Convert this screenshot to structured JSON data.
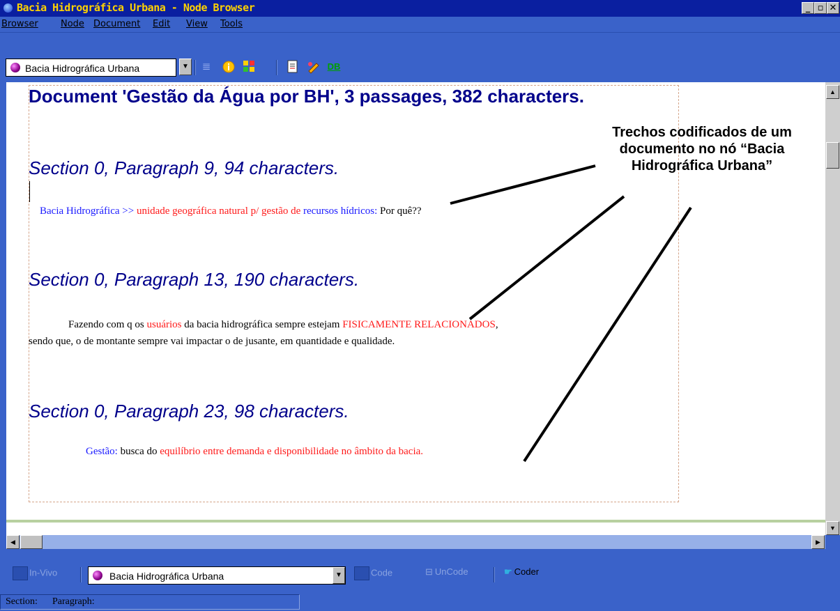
{
  "window": {
    "title": "Bacia Hidrográfica Urbana - Node Browser",
    "controls": [
      "_",
      "▫",
      "✕"
    ]
  },
  "menu": [
    {
      "label": "Browser"
    },
    {
      "label": "Node"
    },
    {
      "label": "Document"
    },
    {
      "label": "Edit"
    },
    {
      "label": "View"
    },
    {
      "label": "Tools"
    }
  ],
  "toolbar": {
    "node_select": "Bacia Hidrográfica Urbana",
    "icons": [
      "browse-passages-icon",
      "info-icon",
      "coding-stripes-icon",
      "report-icon",
      "edit-node-icon",
      "db-icon"
    ],
    "db_label": "DB"
  },
  "document": {
    "title": "Document 'Gestão da Água por BH',  3 passages, 382 characters.",
    "sections": [
      {
        "heading": "Section 0, Paragraph 9, 94 characters.",
        "text": [
          {
            "t": "Bacia Hidrográfica >> ",
            "c": "blue"
          },
          {
            "t": "unidade geográfica natural p/ gestão de ",
            "c": "red"
          },
          {
            "t": "recursos hídricos:",
            "c": "blue"
          },
          {
            "t": " Por quê??",
            "c": "black"
          }
        ]
      },
      {
        "heading": "Section 0, Paragraph 13, 190 characters.",
        "text": [
          {
            "t": "Fazendo com q os ",
            "c": "black"
          },
          {
            "t": "usuários",
            "c": "red"
          },
          {
            "t": " da bacia hidrográfica sempre estejam ",
            "c": "black"
          },
          {
            "t": "FISICAMENTE RELACIONADOS",
            "c": "red"
          },
          {
            "t": ",",
            "c": "black"
          }
        ],
        "text2": "sendo que, o de montante sempre vai impactar o de jusante, em quantidade e qualidade."
      },
      {
        "heading": "Section 0, Paragraph 23, 98 characters.",
        "text": [
          {
            "t": "Gestão:",
            "c": "blue"
          },
          {
            "t": " busca do ",
            "c": "black"
          },
          {
            "t": "equilíbrio entre demanda e disponibilidade no âmbito da bacia.",
            "c": "red"
          }
        ]
      }
    ]
  },
  "callout": {
    "line1": "Trechos codificados de um",
    "line2": "documento no nó “Bacia",
    "line3": "Hidrográfica Urbana”"
  },
  "bottom": {
    "invivo": "In-Vivo",
    "node_select": "Bacia Hidrográfica Urbana",
    "code": "Code",
    "uncode": "UnCode",
    "coder": "Coder"
  },
  "status": {
    "section_label": "Section:",
    "paragraph_label": "Paragraph:"
  },
  "colors": {
    "title_bar": "#0a1fa0",
    "title_text": "#ffd200",
    "chrome": "#3a62c9",
    "heading": "#00008b",
    "coded_blue": "#1a1aff",
    "coded_red": "#ff1a1a"
  }
}
